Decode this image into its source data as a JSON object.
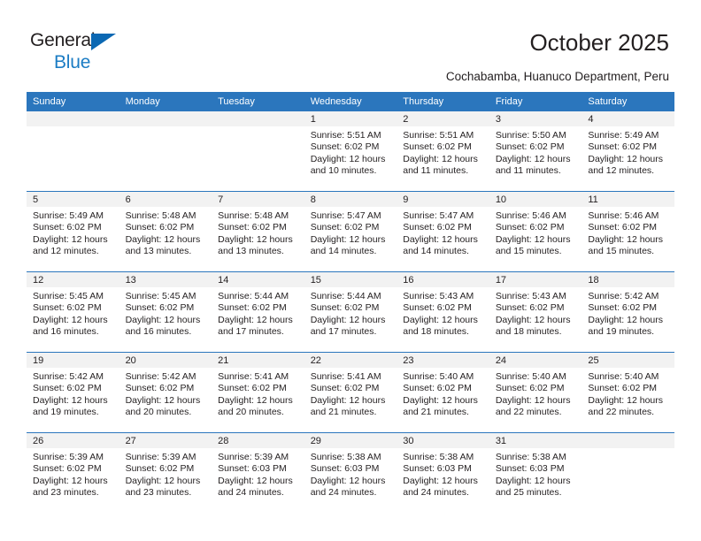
{
  "brand": {
    "line1": "General",
    "line2": "Blue",
    "triangle_color": "#0b68b3",
    "text_color": "#231f20",
    "blue_text_color": "#1b7cc4"
  },
  "header": {
    "title": "October 2025",
    "subtitle": "Cochabamba, Huanuco Department, Peru"
  },
  "colors": {
    "header_bar": "#2b76bd",
    "daynum_band": "#f2f2f2",
    "grid_line": "#2b76bd",
    "text": "#231f20"
  },
  "weekdays": [
    "Sunday",
    "Monday",
    "Tuesday",
    "Wednesday",
    "Thursday",
    "Friday",
    "Saturday"
  ],
  "weeks": [
    [
      {
        "day": "",
        "sunrise": "",
        "sunset": "",
        "daylight_1": "",
        "daylight_2": ""
      },
      {
        "day": "",
        "sunrise": "",
        "sunset": "",
        "daylight_1": "",
        "daylight_2": ""
      },
      {
        "day": "",
        "sunrise": "",
        "sunset": "",
        "daylight_1": "",
        "daylight_2": ""
      },
      {
        "day": "1",
        "sunrise": "Sunrise: 5:51 AM",
        "sunset": "Sunset: 6:02 PM",
        "daylight_1": "Daylight: 12 hours",
        "daylight_2": "and 10 minutes."
      },
      {
        "day": "2",
        "sunrise": "Sunrise: 5:51 AM",
        "sunset": "Sunset: 6:02 PM",
        "daylight_1": "Daylight: 12 hours",
        "daylight_2": "and 11 minutes."
      },
      {
        "day": "3",
        "sunrise": "Sunrise: 5:50 AM",
        "sunset": "Sunset: 6:02 PM",
        "daylight_1": "Daylight: 12 hours",
        "daylight_2": "and 11 minutes."
      },
      {
        "day": "4",
        "sunrise": "Sunrise: 5:49 AM",
        "sunset": "Sunset: 6:02 PM",
        "daylight_1": "Daylight: 12 hours",
        "daylight_2": "and 12 minutes."
      }
    ],
    [
      {
        "day": "5",
        "sunrise": "Sunrise: 5:49 AM",
        "sunset": "Sunset: 6:02 PM",
        "daylight_1": "Daylight: 12 hours",
        "daylight_2": "and 12 minutes."
      },
      {
        "day": "6",
        "sunrise": "Sunrise: 5:48 AM",
        "sunset": "Sunset: 6:02 PM",
        "daylight_1": "Daylight: 12 hours",
        "daylight_2": "and 13 minutes."
      },
      {
        "day": "7",
        "sunrise": "Sunrise: 5:48 AM",
        "sunset": "Sunset: 6:02 PM",
        "daylight_1": "Daylight: 12 hours",
        "daylight_2": "and 13 minutes."
      },
      {
        "day": "8",
        "sunrise": "Sunrise: 5:47 AM",
        "sunset": "Sunset: 6:02 PM",
        "daylight_1": "Daylight: 12 hours",
        "daylight_2": "and 14 minutes."
      },
      {
        "day": "9",
        "sunrise": "Sunrise: 5:47 AM",
        "sunset": "Sunset: 6:02 PM",
        "daylight_1": "Daylight: 12 hours",
        "daylight_2": "and 14 minutes."
      },
      {
        "day": "10",
        "sunrise": "Sunrise: 5:46 AM",
        "sunset": "Sunset: 6:02 PM",
        "daylight_1": "Daylight: 12 hours",
        "daylight_2": "and 15 minutes."
      },
      {
        "day": "11",
        "sunrise": "Sunrise: 5:46 AM",
        "sunset": "Sunset: 6:02 PM",
        "daylight_1": "Daylight: 12 hours",
        "daylight_2": "and 15 minutes."
      }
    ],
    [
      {
        "day": "12",
        "sunrise": "Sunrise: 5:45 AM",
        "sunset": "Sunset: 6:02 PM",
        "daylight_1": "Daylight: 12 hours",
        "daylight_2": "and 16 minutes."
      },
      {
        "day": "13",
        "sunrise": "Sunrise: 5:45 AM",
        "sunset": "Sunset: 6:02 PM",
        "daylight_1": "Daylight: 12 hours",
        "daylight_2": "and 16 minutes."
      },
      {
        "day": "14",
        "sunrise": "Sunrise: 5:44 AM",
        "sunset": "Sunset: 6:02 PM",
        "daylight_1": "Daylight: 12 hours",
        "daylight_2": "and 17 minutes."
      },
      {
        "day": "15",
        "sunrise": "Sunrise: 5:44 AM",
        "sunset": "Sunset: 6:02 PM",
        "daylight_1": "Daylight: 12 hours",
        "daylight_2": "and 17 minutes."
      },
      {
        "day": "16",
        "sunrise": "Sunrise: 5:43 AM",
        "sunset": "Sunset: 6:02 PM",
        "daylight_1": "Daylight: 12 hours",
        "daylight_2": "and 18 minutes."
      },
      {
        "day": "17",
        "sunrise": "Sunrise: 5:43 AM",
        "sunset": "Sunset: 6:02 PM",
        "daylight_1": "Daylight: 12 hours",
        "daylight_2": "and 18 minutes."
      },
      {
        "day": "18",
        "sunrise": "Sunrise: 5:42 AM",
        "sunset": "Sunset: 6:02 PM",
        "daylight_1": "Daylight: 12 hours",
        "daylight_2": "and 19 minutes."
      }
    ],
    [
      {
        "day": "19",
        "sunrise": "Sunrise: 5:42 AM",
        "sunset": "Sunset: 6:02 PM",
        "daylight_1": "Daylight: 12 hours",
        "daylight_2": "and 19 minutes."
      },
      {
        "day": "20",
        "sunrise": "Sunrise: 5:42 AM",
        "sunset": "Sunset: 6:02 PM",
        "daylight_1": "Daylight: 12 hours",
        "daylight_2": "and 20 minutes."
      },
      {
        "day": "21",
        "sunrise": "Sunrise: 5:41 AM",
        "sunset": "Sunset: 6:02 PM",
        "daylight_1": "Daylight: 12 hours",
        "daylight_2": "and 20 minutes."
      },
      {
        "day": "22",
        "sunrise": "Sunrise: 5:41 AM",
        "sunset": "Sunset: 6:02 PM",
        "daylight_1": "Daylight: 12 hours",
        "daylight_2": "and 21 minutes."
      },
      {
        "day": "23",
        "sunrise": "Sunrise: 5:40 AM",
        "sunset": "Sunset: 6:02 PM",
        "daylight_1": "Daylight: 12 hours",
        "daylight_2": "and 21 minutes."
      },
      {
        "day": "24",
        "sunrise": "Sunrise: 5:40 AM",
        "sunset": "Sunset: 6:02 PM",
        "daylight_1": "Daylight: 12 hours",
        "daylight_2": "and 22 minutes."
      },
      {
        "day": "25",
        "sunrise": "Sunrise: 5:40 AM",
        "sunset": "Sunset: 6:02 PM",
        "daylight_1": "Daylight: 12 hours",
        "daylight_2": "and 22 minutes."
      }
    ],
    [
      {
        "day": "26",
        "sunrise": "Sunrise: 5:39 AM",
        "sunset": "Sunset: 6:02 PM",
        "daylight_1": "Daylight: 12 hours",
        "daylight_2": "and 23 minutes."
      },
      {
        "day": "27",
        "sunrise": "Sunrise: 5:39 AM",
        "sunset": "Sunset: 6:02 PM",
        "daylight_1": "Daylight: 12 hours",
        "daylight_2": "and 23 minutes."
      },
      {
        "day": "28",
        "sunrise": "Sunrise: 5:39 AM",
        "sunset": "Sunset: 6:03 PM",
        "daylight_1": "Daylight: 12 hours",
        "daylight_2": "and 24 minutes."
      },
      {
        "day": "29",
        "sunrise": "Sunrise: 5:38 AM",
        "sunset": "Sunset: 6:03 PM",
        "daylight_1": "Daylight: 12 hours",
        "daylight_2": "and 24 minutes."
      },
      {
        "day": "30",
        "sunrise": "Sunrise: 5:38 AM",
        "sunset": "Sunset: 6:03 PM",
        "daylight_1": "Daylight: 12 hours",
        "daylight_2": "and 24 minutes."
      },
      {
        "day": "31",
        "sunrise": "Sunrise: 5:38 AM",
        "sunset": "Sunset: 6:03 PM",
        "daylight_1": "Daylight: 12 hours",
        "daylight_2": "and 25 minutes."
      },
      {
        "day": "",
        "sunrise": "",
        "sunset": "",
        "daylight_1": "",
        "daylight_2": ""
      }
    ]
  ]
}
